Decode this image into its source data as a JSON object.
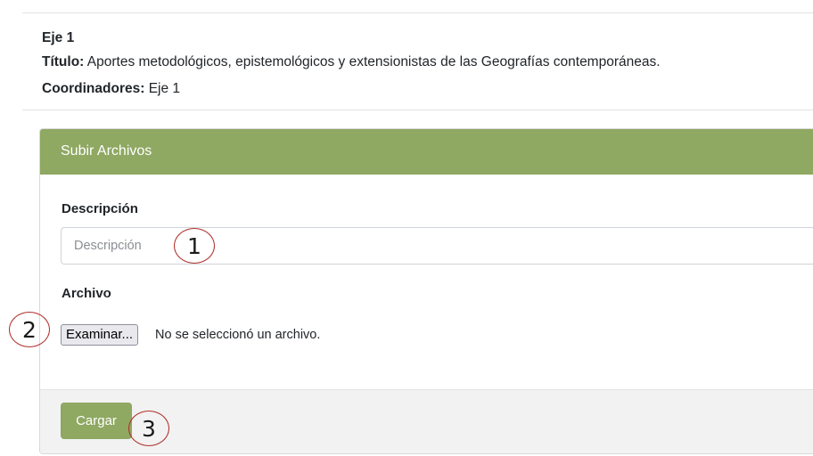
{
  "axis": {
    "title": "Eje 1",
    "titulo_label": "Título:",
    "titulo_value": " Aportes metodológicos, epistemológicos y extensionistas de las Geografías contemporáneas.",
    "coordinadores_label": "Coordinadores:",
    "coordinadores_value": " Eje 1"
  },
  "upload": {
    "header": "Subir Archivos",
    "description_label": "Descripción",
    "description_placeholder": "Descripción",
    "description_value": "",
    "file_label": "Archivo",
    "browse_button": "Examinar...",
    "file_status": "No se seleccionó un archivo.",
    "submit_button": "Cargar"
  },
  "callouts": [
    "1",
    "2",
    "3"
  ],
  "colors": {
    "accent": "#8fa862",
    "callout_ring": "#b0302c"
  }
}
